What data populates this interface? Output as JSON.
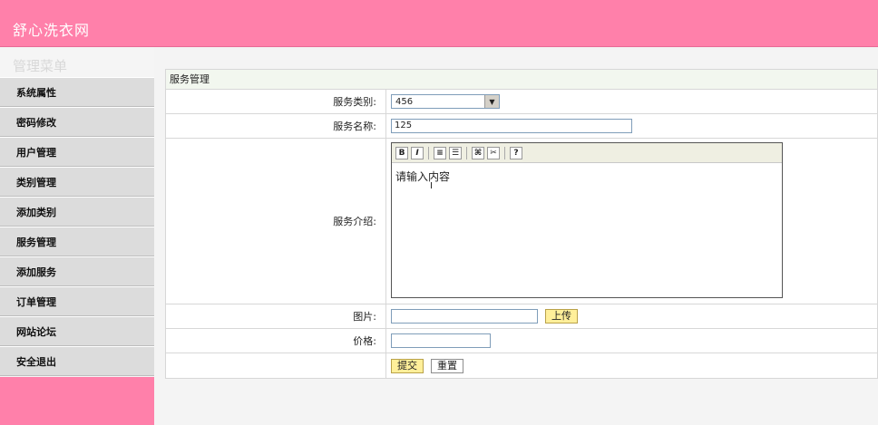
{
  "app": {
    "title": "舒心洗衣网"
  },
  "sidebar": {
    "heading": "管理菜单",
    "items": [
      {
        "label": "系统属性"
      },
      {
        "label": "密码修改"
      },
      {
        "label": "用户管理"
      },
      {
        "label": "类别管理"
      },
      {
        "label": "添加类别"
      },
      {
        "label": "服务管理"
      },
      {
        "label": "添加服务"
      },
      {
        "label": "订单管理"
      },
      {
        "label": "网站论坛"
      },
      {
        "label": "安全退出"
      }
    ]
  },
  "panel": {
    "title": "服务管理",
    "fields": {
      "category_label": "服务类别:",
      "category_value": "456",
      "name_label": "服务名称:",
      "name_value": "125",
      "intro_label": "服务介绍:",
      "intro_placeholder": "请输入内容",
      "image_label": "图片:",
      "upload_button": "上传",
      "price_label": "价格:"
    },
    "actions": {
      "submit": "提交",
      "reset": "重置"
    }
  },
  "editor_toolbar": [
    "bold-icon",
    "italic-icon",
    "ordered-list-icon",
    "unordered-list-icon",
    "link-icon",
    "unlink-icon",
    "help-icon"
  ],
  "colors": {
    "header": "#ff80aa",
    "sidebar": "#dcdcdc",
    "panel_border": "#d7d7d7",
    "button_yellow": "#ffef9a"
  }
}
